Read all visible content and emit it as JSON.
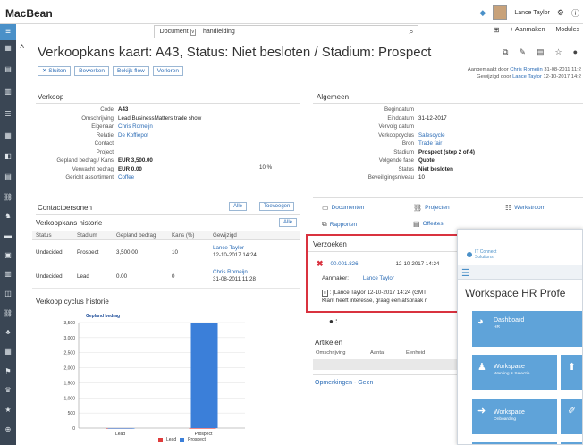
{
  "app": {
    "brand": "MacBean"
  },
  "search": {
    "scope": "Document",
    "value": "handleiding"
  },
  "topbar": {
    "user": "Lance Taylor",
    "create_label": "+ Aanmaken",
    "modules_label": "Modules"
  },
  "page": {
    "title": "Verkoopkans kaart: A43, Status: Niet besloten / Stadium: Prospect",
    "buttons": [
      "✕ Sluiten",
      "Bewerken",
      "Bekijk flow",
      "Verloren"
    ],
    "created_label": "Aangemaakt door",
    "created_by": "Chris Romeijn",
    "created_date": "31-08-2011 11:2",
    "modified_label": "Gewijzigd door",
    "modified_by": "Lance Taylor",
    "modified_date": "12-10-2017 14:2"
  },
  "verkoop": {
    "heading": "Verkoop",
    "rows": [
      {
        "k": "Code",
        "v": "A43",
        "style": "b"
      },
      {
        "k": "Omschrijving",
        "v": "Lead BusinessMatters trade show",
        "style": ""
      },
      {
        "k": "Eigenaar",
        "v": "Chris Romeijn",
        "style": "l"
      },
      {
        "k": "Relatie",
        "v": "De Koffiepot",
        "style": "l"
      },
      {
        "k": "Contact",
        "v": "",
        "style": ""
      },
      {
        "k": "Project",
        "v": "",
        "style": ""
      },
      {
        "k": "Gepland bedrag / Kans",
        "v": "EUR 3,500.00",
        "style": "b"
      },
      {
        "k": "Verwacht bedrag",
        "v": "EUR 0.00",
        "style": "b"
      },
      {
        "k": "Gericht assortiment",
        "v": "Coffee",
        "style": "l"
      }
    ],
    "kans_pct": "10 %"
  },
  "algemeen": {
    "heading": "Algemeen",
    "rows": [
      {
        "k": "Begindatum",
        "v": "",
        "style": ""
      },
      {
        "k": "Einddatum",
        "v": "31-12-2017",
        "style": ""
      },
      {
        "k": "Vervolg datum",
        "v": "",
        "style": ""
      },
      {
        "k": "Verkoopcyclus",
        "v": "Salescycle",
        "style": "l"
      },
      {
        "k": "Bron",
        "v": "Trade fair",
        "style": "l"
      },
      {
        "k": "Stadium",
        "v": "Prospect (step 2 of 4)",
        "style": "b"
      },
      {
        "k": "Volgende fase",
        "v": "Quote",
        "style": "b"
      },
      {
        "k": "Status",
        "v": "Niet besloten",
        "style": "b"
      },
      {
        "k": "Beveiligingsniveau",
        "v": "10",
        "style": ""
      }
    ]
  },
  "contactpersonen": {
    "heading": "Contactpersonen",
    "alle": "Alle",
    "toevoegen": "Toevoegen"
  },
  "historie": {
    "heading": "Verkoopkans historie",
    "alle": "Alle",
    "columns": [
      "Status",
      "Stadium",
      "Gepland bedrag",
      "Kans (%)",
      "Gewijzigd"
    ],
    "rows": [
      {
        "status": "Undecided",
        "stadium": "Prospect",
        "bedrag": "3,500.00",
        "kans": "10",
        "who": "Lance Taylor",
        "when": "12-10-2017 14:24"
      },
      {
        "status": "Undecided",
        "stadium": "Lead",
        "bedrag": "0.00",
        "kans": "0",
        "who": "Chris Romeijn",
        "when": "31-08-2011 11:28"
      }
    ]
  },
  "cyclus": {
    "heading": "Verkoop cyclus historie"
  },
  "chart_data": {
    "type": "bar",
    "title": "",
    "ylabel": "Gepland bedrag",
    "categories": [
      "Lead",
      "Prospect"
    ],
    "series": [
      {
        "name": "Lead",
        "color": "#e03c3c",
        "values": [
          0,
          0
        ]
      },
      {
        "name": "Prospect",
        "color": "#3b7fd9",
        "values": [
          0,
          3500
        ]
      }
    ],
    "ylim": [
      0,
      3500
    ],
    "yticks": [
      "0",
      "500",
      "1,000",
      "1,500",
      "2,000",
      "2,500",
      "3,000",
      "3,500"
    ]
  },
  "tiles": [
    {
      "icon": "📄",
      "label": "Documenten",
      "name": "documenten-link"
    },
    {
      "icon": "⛓",
      "label": "Projecten",
      "name": "projecten-link"
    },
    {
      "icon": "☷",
      "label": "Werkstroom",
      "name": "werkstroom-link"
    },
    {
      "icon": "⧉",
      "label": "Rapporten",
      "name": "rapporten-link"
    },
    {
      "icon": "▤",
      "label": "Offertes",
      "name": "offertes-link"
    }
  ],
  "verzoeken": {
    "heading": "Verzoeken",
    "id": "00.001.826",
    "date": "12-10-2017 14:24",
    "aanmaker_label": "Aanmaker:",
    "aanmaker": "Lance Taylor",
    "line1": ": [Lance Taylor 12-10-2017 14:24 (GMT",
    "line2": "Klant heeft interesse, graag een afspraak r"
  },
  "artikelen": {
    "heading": "Artikelen",
    "columns": [
      "Omschrijving",
      "Aantal",
      "Eenheid"
    ]
  },
  "opmerkingen": {
    "label": "Opmerkingen - Geen"
  },
  "workspace": {
    "logo_line1": "IT Connect",
    "logo_line2": "Solutions",
    "title": "Workspace HR Profe",
    "tiles": [
      {
        "label": "Dashboard",
        "sub": "HR"
      },
      {
        "label": "Workspace",
        "sub": "Werving & Selectie"
      },
      {
        "label": "Workspace",
        "sub": "Onboarding"
      }
    ]
  }
}
